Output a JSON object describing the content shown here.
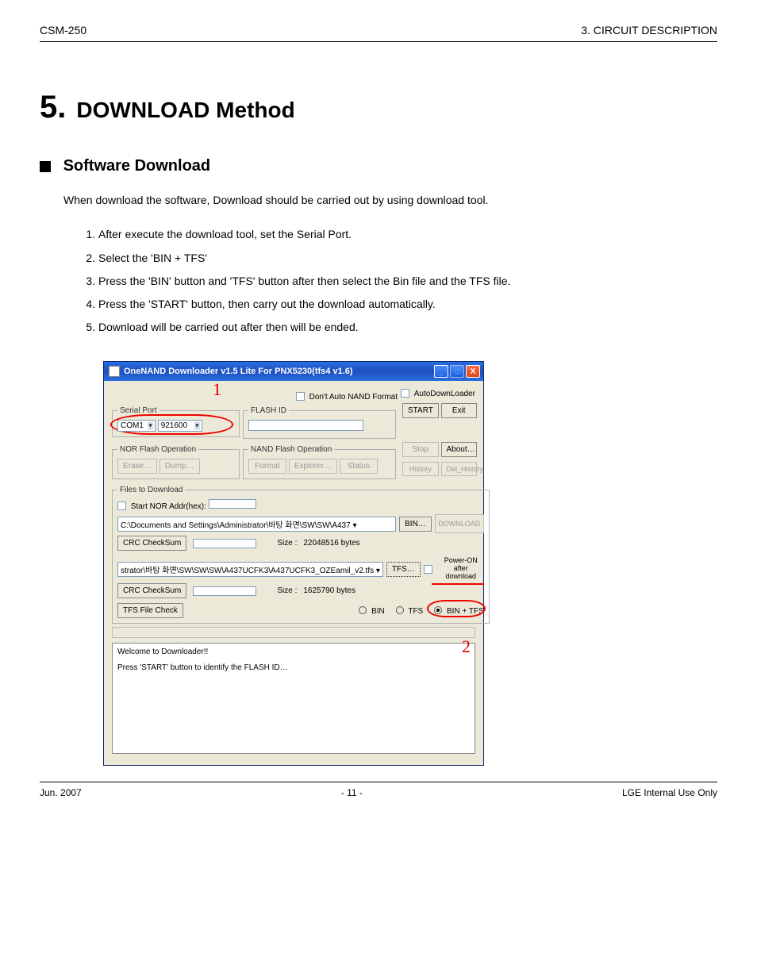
{
  "doc": {
    "header_left": "CSM-250",
    "header_right": "3. CIRCUIT DESCRIPTION",
    "footer_left": "Jun. 2007",
    "footer_center": "- 11 -",
    "footer_right": "LGE Internal Use Only"
  },
  "section": {
    "number": "5.",
    "title": "DOWNLOAD Method",
    "subtitle": "Software Download",
    "para": "When download the software, Download should be carried out by using download tool.",
    "steps": [
      "After execute the download tool, set the Serial Port.",
      "Select the 'BIN + TFS'",
      "Press the 'BIN' button and 'TFS' button after then select the Bin file and the TFS file.",
      "Press the 'START' button, then carry out the download automatically.",
      "Download will be carried out after then will be ended."
    ]
  },
  "app": {
    "title": "OneNAND Downloader v1.5 Lite For PNX5230(tfs4 v1.6)",
    "checkbox_noformat": "Don't Auto NAND Format",
    "checkbox_autodl": "AutoDownLoader",
    "fs_serial": "Serial Port",
    "com_port": "COM1",
    "baud": "921600",
    "fs_flashid": "FLASH ID",
    "btn_start": "START",
    "btn_exit": "Exit",
    "btn_stop": "Stop",
    "btn_about": "About…",
    "btn_history": "History",
    "btn_delhist": "Del_History",
    "fs_nor": "NOR Flash Operation",
    "btn_erase": "Erase…",
    "btn_dump": "Dump…",
    "fs_nand": "NAND Flash Operation",
    "btn_format": "Format",
    "btn_explorer": "Explorer…",
    "btn_status": "Status",
    "fs_files": "Files to Download",
    "chk_startaddr": "Start NOR Addr(hex):",
    "bin_path": "C:\\Documents and Settings\\Administrator\\바탕 화면\\SW\\SW\\A437 ▾",
    "btn_bin": "BIN…",
    "btn_download": "DOWNLOAD",
    "crc_label": "CRC CheckSum",
    "size_label": "Size :",
    "bin_size": "22048516 bytes",
    "tfs_path": "strator\\바탕 화면\\SW\\SW\\SW\\A437UCFK3\\A437UCFK3_OZEamil_v2.tfs ▾",
    "btn_tfs": "TFS…",
    "poweron": "Power-ON after download",
    "tfs_size": "1625790 bytes",
    "btn_tfscheck": "TFS File Check",
    "radio_bin": "BIN",
    "radio_tfs": "TFS",
    "radio_bintfs": "BIN + TFS",
    "anno1": "1",
    "anno2": "2",
    "log_line1": "Welcome to Downloader!!",
    "log_line2": "Press 'START' button to identify the FLASH ID…"
  }
}
